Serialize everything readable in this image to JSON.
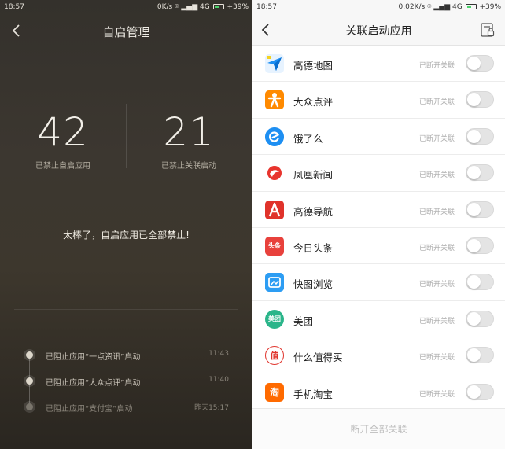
{
  "left": {
    "status": {
      "time": "18:57",
      "speed": "0K/s",
      "network": "4G",
      "battery": "+39%"
    },
    "title": "自启管理",
    "stats": [
      {
        "value": "42",
        "label": "已禁止自启应用"
      },
      {
        "value": "21",
        "label": "已禁止关联启动"
      }
    ],
    "message": "太棒了，自启应用已全部禁止!",
    "timeline": [
      {
        "text": "已阻止应用“一点资讯”启动",
        "time": "11:43"
      },
      {
        "text": "已阻止应用“大众点评”启动",
        "time": "11:40"
      },
      {
        "text": "已阻止应用“支付宝”启动",
        "time": "昨天15:17"
      }
    ]
  },
  "right": {
    "status": {
      "time": "18:57",
      "speed": "0.02K/s",
      "network": "4G",
      "battery": "+39%"
    },
    "title": "关联启动应用",
    "items": [
      {
        "name": "高德地图",
        "state": "已断开关联",
        "icon": "amap-icon",
        "color": "#ffffff"
      },
      {
        "name": "大众点评",
        "state": "已断开关联",
        "icon": "dianping-icon",
        "color": "#ff8a00"
      },
      {
        "name": "饿了么",
        "state": "已断开关联",
        "icon": "eleme-icon",
        "color": "#1e8ff2"
      },
      {
        "name": "凤凰新闻",
        "state": "已断开关联",
        "icon": "ifeng-icon",
        "color": "#ffffff"
      },
      {
        "name": "高德导航",
        "state": "已断开关联",
        "icon": "amap-nav-icon",
        "color": "#e0332b"
      },
      {
        "name": "今日头条",
        "state": "已断开关联",
        "icon": "toutiao-icon",
        "color": "#e8413c",
        "glyph": "头条"
      },
      {
        "name": "快图浏览",
        "state": "已断开关联",
        "icon": "quickpic-icon",
        "color": "#2d9df3"
      },
      {
        "name": "美团",
        "state": "已断开关联",
        "icon": "meituan-icon",
        "color": "#2bb58a",
        "glyph": "美团"
      },
      {
        "name": "什么值得买",
        "state": "已断开关联",
        "icon": "smzdm-icon",
        "color": "#ffffff",
        "glyph": "值"
      },
      {
        "name": "手机淘宝",
        "state": "已断开关联",
        "icon": "taobao-icon",
        "color": "#ff6a00",
        "glyph": "淘"
      }
    ],
    "bottom_button": "断开全部关联"
  }
}
